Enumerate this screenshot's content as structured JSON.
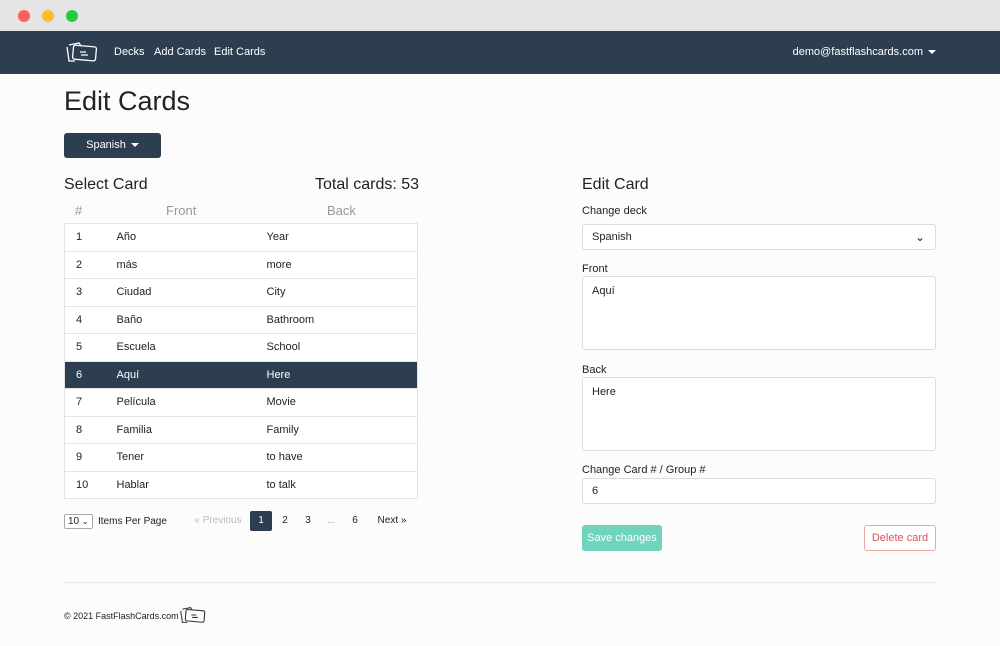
{
  "nav": {
    "links": [
      "Decks",
      "Add Cards",
      "Edit Cards"
    ],
    "user": "demo@fastflashcards.com"
  },
  "page": {
    "title": "Edit Cards",
    "deck_button": "Spanish"
  },
  "select": {
    "title": "Select Card",
    "total": "Total cards: 53",
    "headers": [
      "#",
      "Front",
      "Back"
    ],
    "rows": [
      [
        "1",
        "Año",
        "Year"
      ],
      [
        "2",
        "más",
        "more"
      ],
      [
        "3",
        "Ciudad",
        "City"
      ],
      [
        "4",
        "Baño",
        "Bathroom"
      ],
      [
        "5",
        "Escuela",
        "School"
      ],
      [
        "6",
        "Aquí",
        "Here"
      ],
      [
        "7",
        "Película",
        "Movie"
      ],
      [
        "8",
        "Familia",
        "Family"
      ],
      [
        "9",
        "Tener",
        "to have"
      ],
      [
        "10",
        "Hablar",
        "to talk"
      ]
    ],
    "selected_row": 6,
    "per_page": "10",
    "per_page_label": "Items Per Page",
    "pagination": {
      "prev": "« Previous",
      "pages": [
        "1",
        "2",
        "3",
        "...",
        "6"
      ],
      "current": "1",
      "next": "Next »"
    }
  },
  "edit": {
    "title": "Edit Card",
    "deck_label": "Change deck",
    "deck_value": "Spanish",
    "front_label": "Front",
    "front_value": "Aquí",
    "back_label": "Back",
    "back_value": "Here",
    "group_label": "Change Card # / Group #",
    "group_value": "6",
    "save": "Save changes",
    "delete": "Delete card"
  },
  "footer": {
    "copyright": "© 2021 FastFlashCards.com"
  },
  "colors": {
    "navbar": "#2c3e50",
    "save": "#6fd3be",
    "delete": "#e74c3c"
  }
}
